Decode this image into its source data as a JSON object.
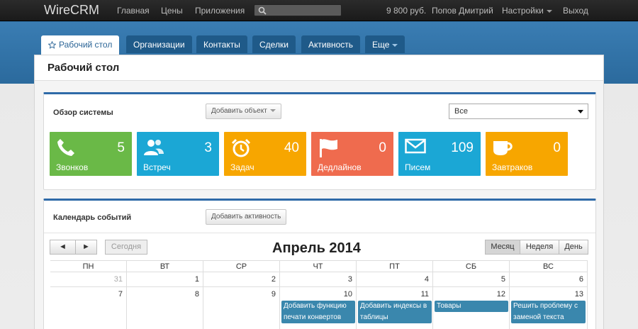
{
  "topbar": {
    "brand": "WireCRM",
    "links": [
      "Главная",
      "Цены",
      "Приложения"
    ],
    "balance": "9 800 руб.",
    "user": "Попов Дмитрий",
    "settings": "Настройки",
    "logout": "Выход"
  },
  "tabs": [
    "Рабочий стол",
    "Организации",
    "Контакты",
    "Сделки",
    "Активность",
    "Еще"
  ],
  "page_title": "Рабочий стол",
  "overview": {
    "title": "Обзор системы",
    "add_button": "Добавить объект",
    "filter_value": "Все",
    "tiles": [
      {
        "label": "Звонков",
        "count": "5",
        "color": "#6ab947",
        "icon": "phone-icon"
      },
      {
        "label": "Встреч",
        "count": "3",
        "color": "#1ba7d5",
        "icon": "users-icon"
      },
      {
        "label": "Задач",
        "count": "40",
        "color": "#f7a600",
        "icon": "alarm-clock-icon"
      },
      {
        "label": "Дедлайнов",
        "count": "0",
        "color": "#ef6b4e",
        "icon": "flag-icon"
      },
      {
        "label": "Писем",
        "count": "109",
        "color": "#1ba7d5",
        "icon": "envelope-icon"
      },
      {
        "label": "Завтраков",
        "count": "0",
        "color": "#f7a600",
        "icon": "coffee-cup-icon"
      }
    ]
  },
  "calendar": {
    "title": "Календарь событий",
    "add_button": "Добавить активность",
    "prev": "◄",
    "next": "►",
    "today": "Сегодня",
    "month_title": "Апрель 2014",
    "views": [
      "Месяц",
      "Неделя",
      "День"
    ],
    "weekdays": [
      "ПН",
      "ВТ",
      "СР",
      "ЧТ",
      "ПТ",
      "СБ",
      "ВС"
    ],
    "week1": [
      "31",
      "1",
      "2",
      "3",
      "4",
      "5",
      "6"
    ],
    "week2": [
      "7",
      "8",
      "9",
      "10",
      "11",
      "12",
      "13"
    ],
    "events": {
      "thu": "Добавить функцию печати конвертов",
      "fri": "Добавить индексы в таблицы",
      "sat": "Товары",
      "sun": "Решить проблему с заменой текста"
    }
  }
}
